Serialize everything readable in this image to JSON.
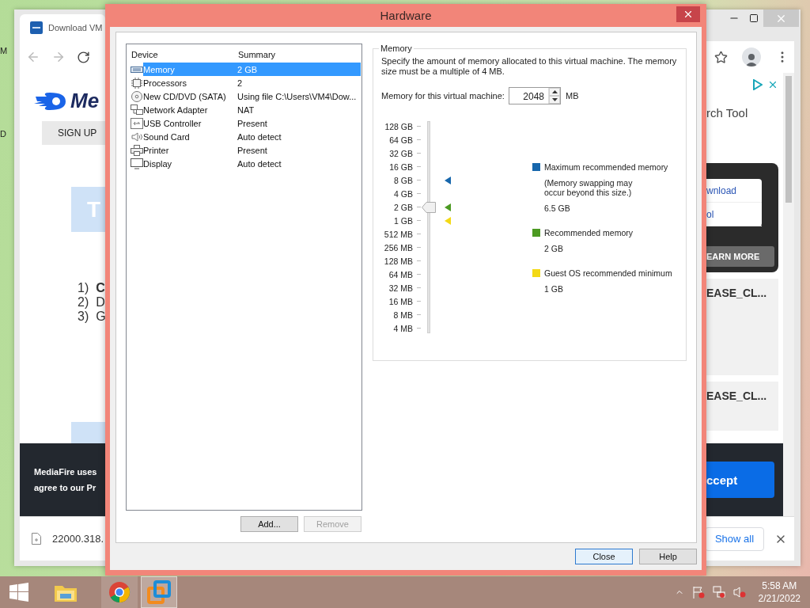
{
  "desktop": {
    "icon_labels": [
      "M",
      "D"
    ]
  },
  "browser": {
    "tab_title": "Download VM",
    "page": {
      "logo_text": "Me",
      "signup": "SIGN UP",
      "block_letter": "T",
      "steps": [
        {
          "number": "1)",
          "text": "C",
          "bold": true
        },
        {
          "number": "2)",
          "text": "D",
          "bold": false
        },
        {
          "number": "3)",
          "text": "G",
          "bold": false
        }
      ],
      "ad_title": "rch Tool",
      "ad_links": [
        "wnload",
        "ol"
      ],
      "ad_button": "EARN MORE",
      "files": [
        "EASE_CL...",
        "EASE_CL..."
      ],
      "cookie_lines": [
        "MediaFire uses",
        "agree to our Pr"
      ],
      "accept": "ccept"
    },
    "download": {
      "file": "22000.318.",
      "show_all": "Show all"
    }
  },
  "dialog": {
    "title": "Hardware",
    "columns": [
      "Device",
      "Summary"
    ],
    "devices": [
      {
        "kind": "memory",
        "name": "Memory",
        "summary": "2 GB",
        "selected": true
      },
      {
        "kind": "cpu",
        "name": "Processors",
        "summary": "2",
        "selected": false
      },
      {
        "kind": "disc",
        "name": "New CD/DVD (SATA)",
        "summary": "Using file C:\\Users\\VM4\\Dow...",
        "selected": false
      },
      {
        "kind": "network",
        "name": "Network Adapter",
        "summary": "NAT",
        "selected": false
      },
      {
        "kind": "usb",
        "name": "USB Controller",
        "summary": "Present",
        "selected": false
      },
      {
        "kind": "sound",
        "name": "Sound Card",
        "summary": "Auto detect",
        "selected": false
      },
      {
        "kind": "printer",
        "name": "Printer",
        "summary": "Present",
        "selected": false
      },
      {
        "kind": "display",
        "name": "Display",
        "summary": "Auto detect",
        "selected": false
      }
    ],
    "list_buttons": [
      {
        "label": "Add...",
        "disabled": false
      },
      {
        "label": "Remove",
        "disabled": true
      }
    ],
    "memory": {
      "title": "Memory",
      "description": "Specify the amount of memory allocated to this virtual machine. The memory size must be a multiple of 4 MB.",
      "field_label": "Memory for this virtual machine:",
      "value": "2048",
      "unit": "MB",
      "scale": [
        {
          "label": "128 GB"
        },
        {
          "label": "64 GB"
        },
        {
          "label": "32 GB"
        },
        {
          "label": "16 GB"
        },
        {
          "label": "8 GB",
          "color": "#1767ac"
        },
        {
          "label": "4 GB"
        },
        {
          "label": "2 GB",
          "color": "#4c9a22"
        },
        {
          "label": "1 GB",
          "color": "#f3d916"
        },
        {
          "label": "512 MB"
        },
        {
          "label": "256 MB"
        },
        {
          "label": "128 MB"
        },
        {
          "label": "64 MB"
        },
        {
          "label": "32 MB"
        },
        {
          "label": "16 MB"
        },
        {
          "label": "8 MB"
        },
        {
          "label": "4 MB"
        }
      ],
      "level": 0.6,
      "legend": [
        {
          "color": "#1767ac",
          "title": "Maximum recommended memory",
          "note": "(Memory swapping may occur beyond this size.)",
          "value": "6.5 GB"
        },
        {
          "color": "#4c9a22",
          "title": "Recommended memory",
          "value": "2 GB"
        },
        {
          "color": "#f3d916",
          "title": "Guest OS recommended minimum",
          "value": "1 GB"
        }
      ]
    },
    "buttons": [
      {
        "label": "Close",
        "default": true
      },
      {
        "label": "Help",
        "default": false
      }
    ]
  },
  "taskbar": {
    "items": [
      {
        "kind": "explorer",
        "running": false,
        "selected": false
      },
      {
        "kind": "chrome",
        "running": true,
        "selected": false
      },
      {
        "kind": "vmware",
        "running": true,
        "selected": true
      }
    ],
    "time": "5:58 AM",
    "date": "2/21/2022"
  }
}
